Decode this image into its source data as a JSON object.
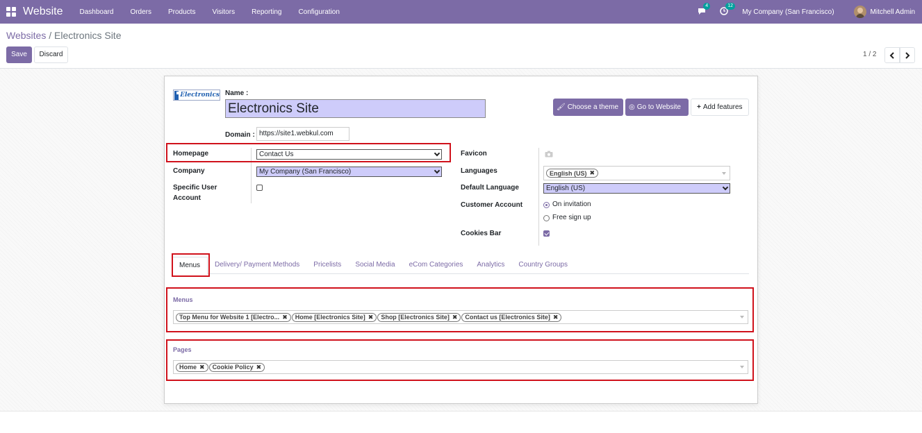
{
  "navbar": {
    "app_name": "Website",
    "menu": [
      "Dashboard",
      "Orders",
      "Products",
      "Visitors",
      "Reporting",
      "Configuration"
    ],
    "messages_count": "4",
    "activities_count": "12",
    "company": "My Company (San Francisco)",
    "user": "Mitchell Admin",
    "color": "#7c6ba6"
  },
  "breadcrumb": {
    "parent": "Websites",
    "separator": "/",
    "current": "Electronics Site"
  },
  "buttons": {
    "save": "Save",
    "discard": "Discard"
  },
  "pager": {
    "value": "1 / 2"
  },
  "form": {
    "name_label": "Name :",
    "name_value": "Electronics Site",
    "logo_text": "Electronics",
    "domain_label": "Domain :",
    "domain_value": "https://site1.webkul.com",
    "actions": {
      "choose_theme": "Choose a theme",
      "go_to_website": "Go to Website",
      "add_features": "Add features"
    },
    "homepage_label": "Homepage",
    "homepage_value": "Contact Us",
    "company_label": "Company",
    "company_value": "My Company (San Francisco)",
    "specific_user_label_1": "Specific User",
    "specific_user_label_2": "Account",
    "favicon_label": "Favicon",
    "languages_label": "Languages",
    "languages_tags": [
      "English (US)"
    ],
    "default_language_label": "Default Language",
    "default_language_value": "English (US)",
    "customer_account_label": "Customer Account",
    "customer_account_options": [
      "On invitation",
      "Free sign up"
    ],
    "cookies_bar_label": "Cookies Bar"
  },
  "tabs": [
    "Menus",
    "Delivery/ Payment Methods",
    "Pricelists",
    "Social Media",
    "eCom Categories",
    "Analytics",
    "Country Groups"
  ],
  "menus_section": {
    "title": "Menus",
    "tags": [
      "Top Menu for Website 1 [Electro...",
      "Home [Electronics Site]",
      "Shop [Electronics Site]",
      "Contact us [Electronics Site]"
    ]
  },
  "pages_section": {
    "title": "Pages",
    "tags": [
      "Home",
      "Cookie Policy"
    ]
  }
}
